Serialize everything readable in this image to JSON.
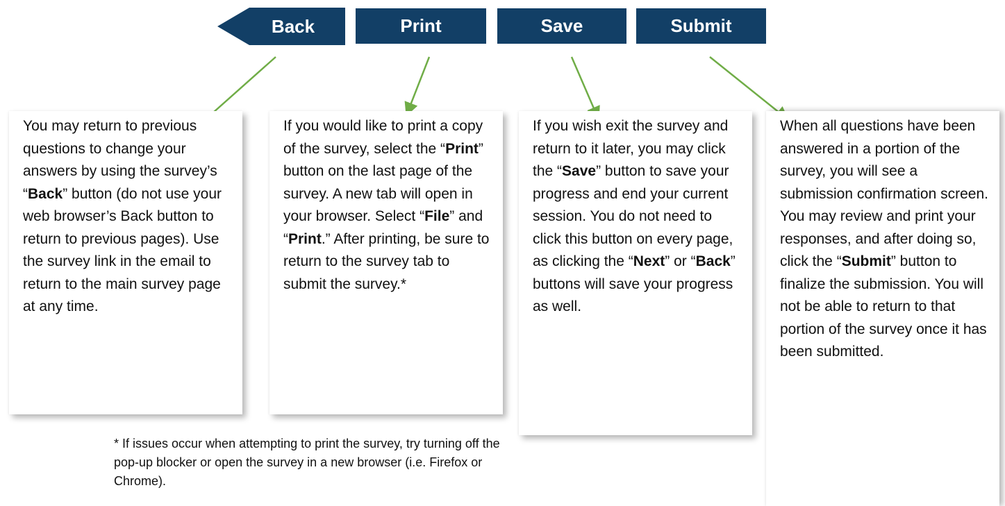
{
  "buttons": {
    "back": "Back",
    "print": "Print",
    "save": "Save",
    "submit": "Submit"
  },
  "cards": {
    "back": {
      "t1": "You may return to previous questions to change your answers by using the survey’s “",
      "b1": "Back",
      "t2": "” button (do not use your web browser’s Back button to return to previous pages). Use the survey link in the email to return to the main survey page at any time."
    },
    "print": {
      "t1": "If you would like to print a copy of the survey, select the “",
      "b1": "Print",
      "t2": "” button on the last page of the survey. A new tab will open in your browser. Select “",
      "b2": "File",
      "t3": "” and “",
      "b3": "Print",
      "t4": ".” After printing, be sure to return to the survey tab to submit the survey.*"
    },
    "save": {
      "t1": "If you wish exit the survey and return to it later, you may click the “",
      "b1": "Save",
      "t2": "” button to save your progress and end your current session. You do not need to click this button on every page, as clicking the “",
      "b2": "Next",
      "t3": "” or “",
      "b3": "Back",
      "t4": "” buttons will save your progress as well."
    },
    "submit": {
      "t1": "When all questions have been answered in a portion of the survey, you will see a submission confirmation screen. You may review and print your responses, and after doing so, click the “",
      "b1": "Submit",
      "t2": "” button to finalize the submission. You will not be able to return to that portion of the survey once it has been submitted."
    }
  },
  "footnote": "* If issues occur when attempting to print the survey, try turning off the pop-up blocker or open the survey in a new browser (i.e. Firefox or Chrome).",
  "colors": {
    "button_bg": "#123f66",
    "button_text": "#ffffff",
    "arrow": "#70ad47"
  }
}
